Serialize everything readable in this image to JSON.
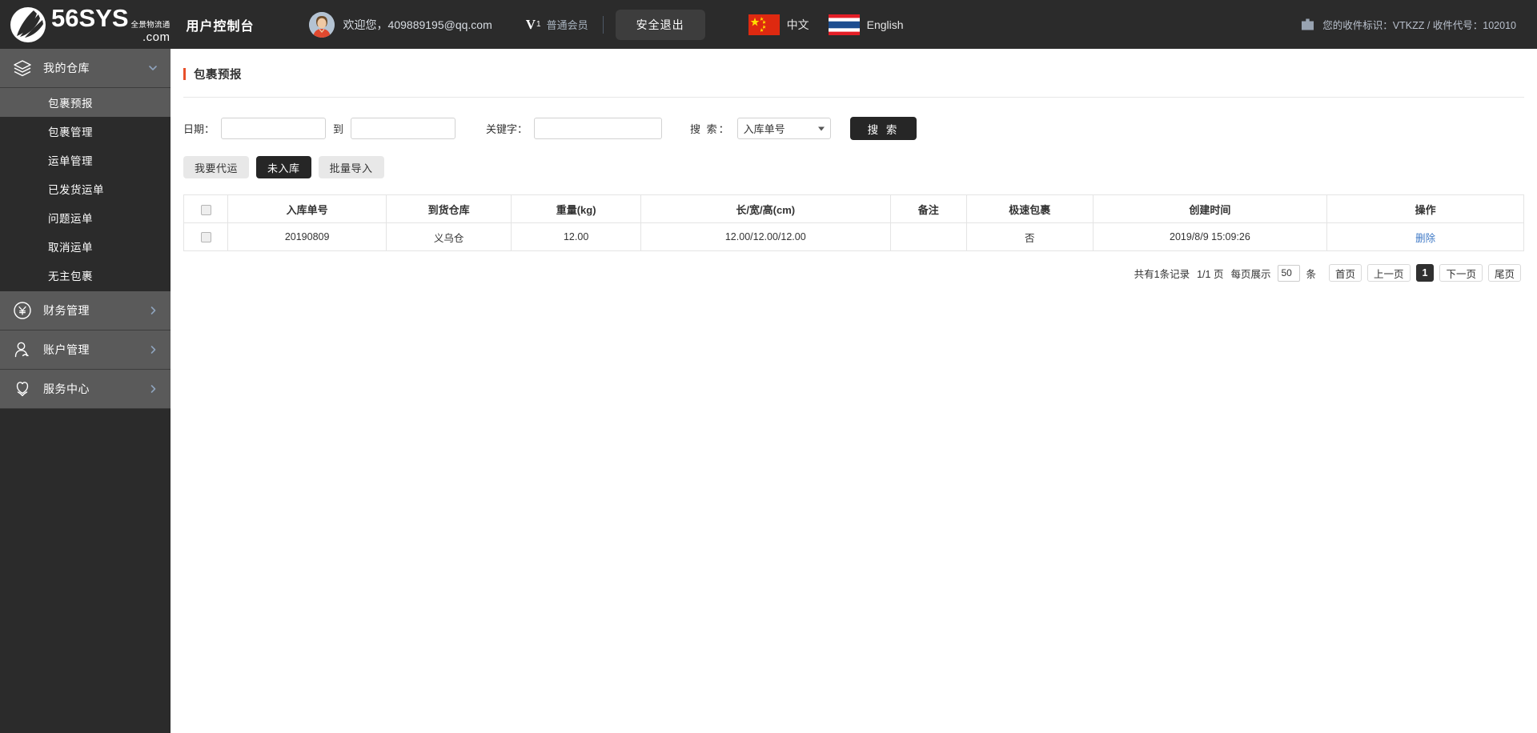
{
  "header": {
    "logo": {
      "brand": "56SYS",
      "tagline": "全景物流通",
      "domain": ".com"
    },
    "console_title": "用户控制台",
    "welcome": "欢迎您，409889195@qq.com",
    "vip": {
      "level": "V",
      "level_num": "1",
      "label": "普通会员"
    },
    "logout_label": "安全退出",
    "languages": [
      {
        "flag": "cn-flag-icon",
        "label": "中文"
      },
      {
        "flag": "th-flag-icon",
        "label": "English"
      }
    ],
    "recipient_info": "您的收件标识：VTKZZ / 收件代号：102010"
  },
  "sidebar": {
    "groups": [
      {
        "label": "我的仓库",
        "icon": "layers-icon",
        "expanded": true,
        "items": [
          {
            "label": "包裹预报",
            "active": true
          },
          {
            "label": "包裹管理",
            "active": false
          },
          {
            "label": "运单管理",
            "active": false
          },
          {
            "label": "已发货运单",
            "active": false
          },
          {
            "label": "问题运单",
            "active": false
          },
          {
            "label": "取消运单",
            "active": false
          },
          {
            "label": "无主包裹",
            "active": false
          }
        ]
      },
      {
        "label": "财务管理",
        "icon": "yuan-circle-icon",
        "expanded": false,
        "items": []
      },
      {
        "label": "账户管理",
        "icon": "user-icon",
        "expanded": false,
        "items": []
      },
      {
        "label": "服务中心",
        "icon": "shield-icon",
        "expanded": false,
        "items": []
      }
    ]
  },
  "main": {
    "page_title": "包裹预报",
    "filters": {
      "date_label": "日期：",
      "date_from_value": "",
      "date_from_placeholder": "",
      "date_to_sep": "到",
      "date_to_value": "",
      "date_to_placeholder": "",
      "keyword_label": "关键字：",
      "keyword_value": "",
      "keyword_placeholder": "",
      "search_select_label": "搜 索：",
      "search_select_value": "入库单号",
      "search_select_options": [
        "入库单号"
      ],
      "search_button": "搜 索"
    },
    "tabs": [
      {
        "label": "我要代运",
        "active": false
      },
      {
        "label": "未入库",
        "active": true
      },
      {
        "label": "批量导入",
        "active": false
      }
    ],
    "table": {
      "columns": [
        "",
        "入库单号",
        "到货仓库",
        "重量(kg)",
        "长/宽/高(cm)",
        "备注",
        "极速包裹",
        "创建时间",
        "操作"
      ],
      "rows": [
        {
          "checked": false,
          "order_no": "20190809",
          "warehouse": "义乌仓",
          "weight": "12.00",
          "dimensions": "12.00/12.00/12.00",
          "remark": "",
          "express": "否",
          "created": "2019/8/9 15:09:26",
          "action": "删除"
        }
      ]
    },
    "pagination": {
      "total_text": "共有1条记录",
      "page_text": "1/1 页",
      "per_page_label": "每页展示",
      "per_page_value": "50",
      "per_page_unit": "条",
      "first": "首页",
      "prev": "上一页",
      "current": "1",
      "next": "下一页",
      "last": "尾页"
    }
  },
  "colors": {
    "topbar_bg": "#2b2b2b",
    "sidebar_bg": "#2b2b2b",
    "sidebar_active": "#5a5a5a",
    "accent_orange": "#e8502a",
    "dark_button": "#262626",
    "link_blue": "#3f79c6"
  }
}
